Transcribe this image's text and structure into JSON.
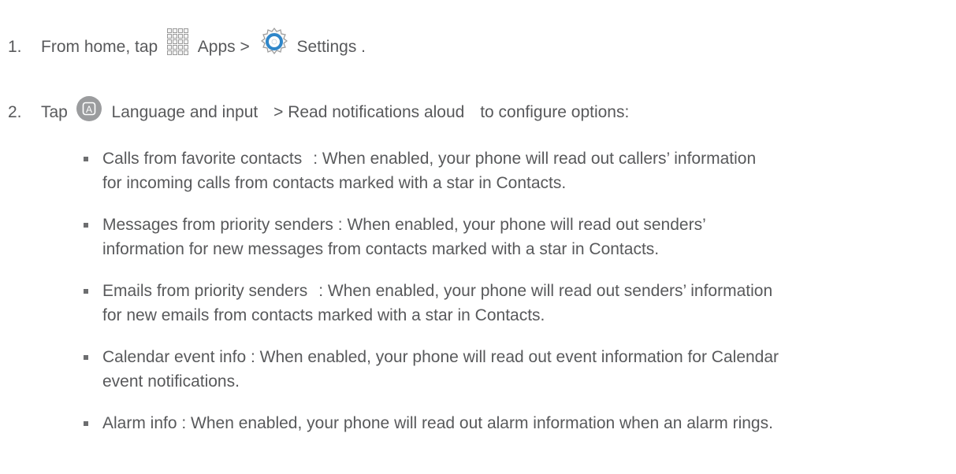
{
  "steps": [
    {
      "number": "1.",
      "prefix": "From home, tap",
      "apps_label": "Apps",
      "separator": ">",
      "settings_label": "Settings",
      "suffix": "."
    },
    {
      "number": "2.",
      "prefix": "Tap",
      "language_label": "Language and input",
      "separator": ">",
      "menu_item": "Read notifications aloud",
      "suffix": "to configure options:"
    }
  ],
  "icons": {
    "apps": "apps-grid-icon",
    "settings": "settings-gear-icon",
    "language": "language-input-icon",
    "language_letter": "A"
  },
  "options": [
    {
      "term": "Calls from favorite contacts",
      "line1": ": When enabled, your phone will read out callers’ information",
      "line2": "for incoming calls from contacts marked with a star in Contacts."
    },
    {
      "term": "Messages from  priority  senders",
      "line1": ": When enabled, your phone will read out senders’",
      "line2": "information for new messages from contacts marked with a star in Contacts."
    },
    {
      "term": "Emails from priority senders",
      "line1": ": When enabled, your phone will read out senders’ information",
      "line2": "for new emails from contacts marked with a star in Contacts."
    },
    {
      "term": "Calendar event info",
      "line1": ": When enabled, your phone will read out event information for Calendar",
      "line2": "event notifications."
    },
    {
      "term": "Alarm info",
      "line1": ": When enabled, your phone will read out alarm information when an alarm rings.",
      "line2": ""
    }
  ],
  "colors": {
    "text": "#58595b",
    "settings_blue": "#2f86c9",
    "icon_gray": "#9a9a9a"
  }
}
